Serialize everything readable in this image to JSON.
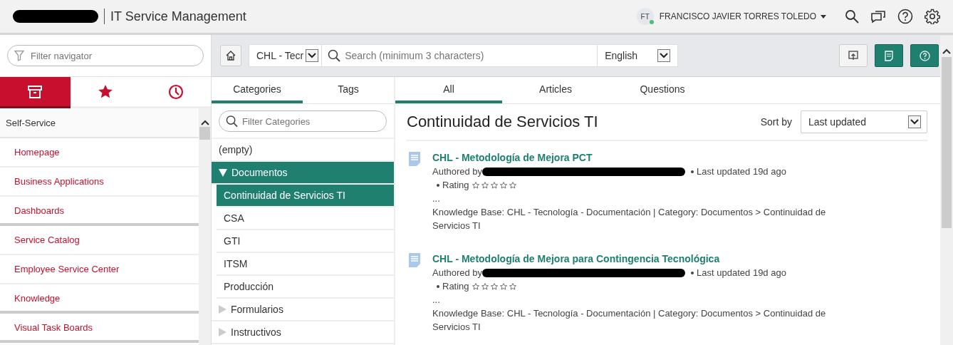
{
  "header": {
    "title": "IT Service Management",
    "user": {
      "initials": "FT",
      "name": "FRANCISCO JAVIER TORRES TOLEDO",
      "online": true
    }
  },
  "navigator": {
    "filter": {
      "placeholder": "Filter navigator"
    },
    "tabs": [
      {
        "kind": "archive",
        "selected": true
      },
      {
        "kind": "favorites",
        "selected": false
      },
      {
        "kind": "history",
        "selected": false
      }
    ],
    "section": {
      "label": "Self-Service",
      "expanded": true,
      "groups": [
        {
          "items": [
            "Homepage",
            "Business Applications",
            "Dashboards"
          ]
        },
        {
          "items": [
            "Service Catalog",
            "Employee Service Center",
            "Knowledge"
          ]
        },
        {
          "items": [
            "Visual Task Boards"
          ]
        }
      ]
    }
  },
  "toolbar": {
    "knowledge_base": "CHL - Tecr",
    "search": {
      "placeholder": "Search (minimum 3 characters)"
    },
    "language": "English"
  },
  "category_tabs": [
    {
      "label": "Categories",
      "selected": true
    },
    {
      "label": "Tags",
      "selected": false
    }
  ],
  "category_filter": {
    "placeholder": "Filter Categories"
  },
  "categories": [
    {
      "label": "(empty)",
      "selected": false
    },
    {
      "label": "Documentos",
      "selected": true,
      "expanded": true,
      "children": [
        {
          "label": "Continuidad de Servicios TI",
          "selected": true
        },
        {
          "label": "CSA",
          "selected": false
        },
        {
          "label": "GTI",
          "selected": false
        },
        {
          "label": "ITSM",
          "selected": false
        },
        {
          "label": "Producción",
          "selected": false
        }
      ]
    },
    {
      "label": "Formularios",
      "selected": false,
      "expanded": false
    },
    {
      "label": "Instructivos",
      "selected": false,
      "expanded": false
    }
  ],
  "result_tabs": [
    {
      "label": "All",
      "selected": true
    },
    {
      "label": "Articles",
      "selected": false
    },
    {
      "label": "Questions",
      "selected": false
    }
  ],
  "content": {
    "title": "Continuidad de Servicios TI",
    "sort_label": "Sort by",
    "sort_value": "Last updated",
    "articles": [
      {
        "title": "CHL - Metodología de Mejora PCT",
        "author_label": "Authored by",
        "updated": "Last updated 19d ago",
        "rating_label": "Rating",
        "stars": 0,
        "snippet": "...",
        "kb": "Knowledge Base: CHL - Tecnología - Documentación | Category: Documentos > Continuidad de Servicios TI"
      },
      {
        "title": "CHL - Metodología de Mejora para Contingencia Tecnológica",
        "author_label": "Authored by",
        "updated": "Last updated 19d ago",
        "rating_label": "Rating",
        "stars": 0,
        "snippet": "...",
        "kb": "Knowledge Base: CHL - Tecnología - Documentación | Category: Documentos > Continuidad de Servicios TI"
      }
    ]
  }
}
